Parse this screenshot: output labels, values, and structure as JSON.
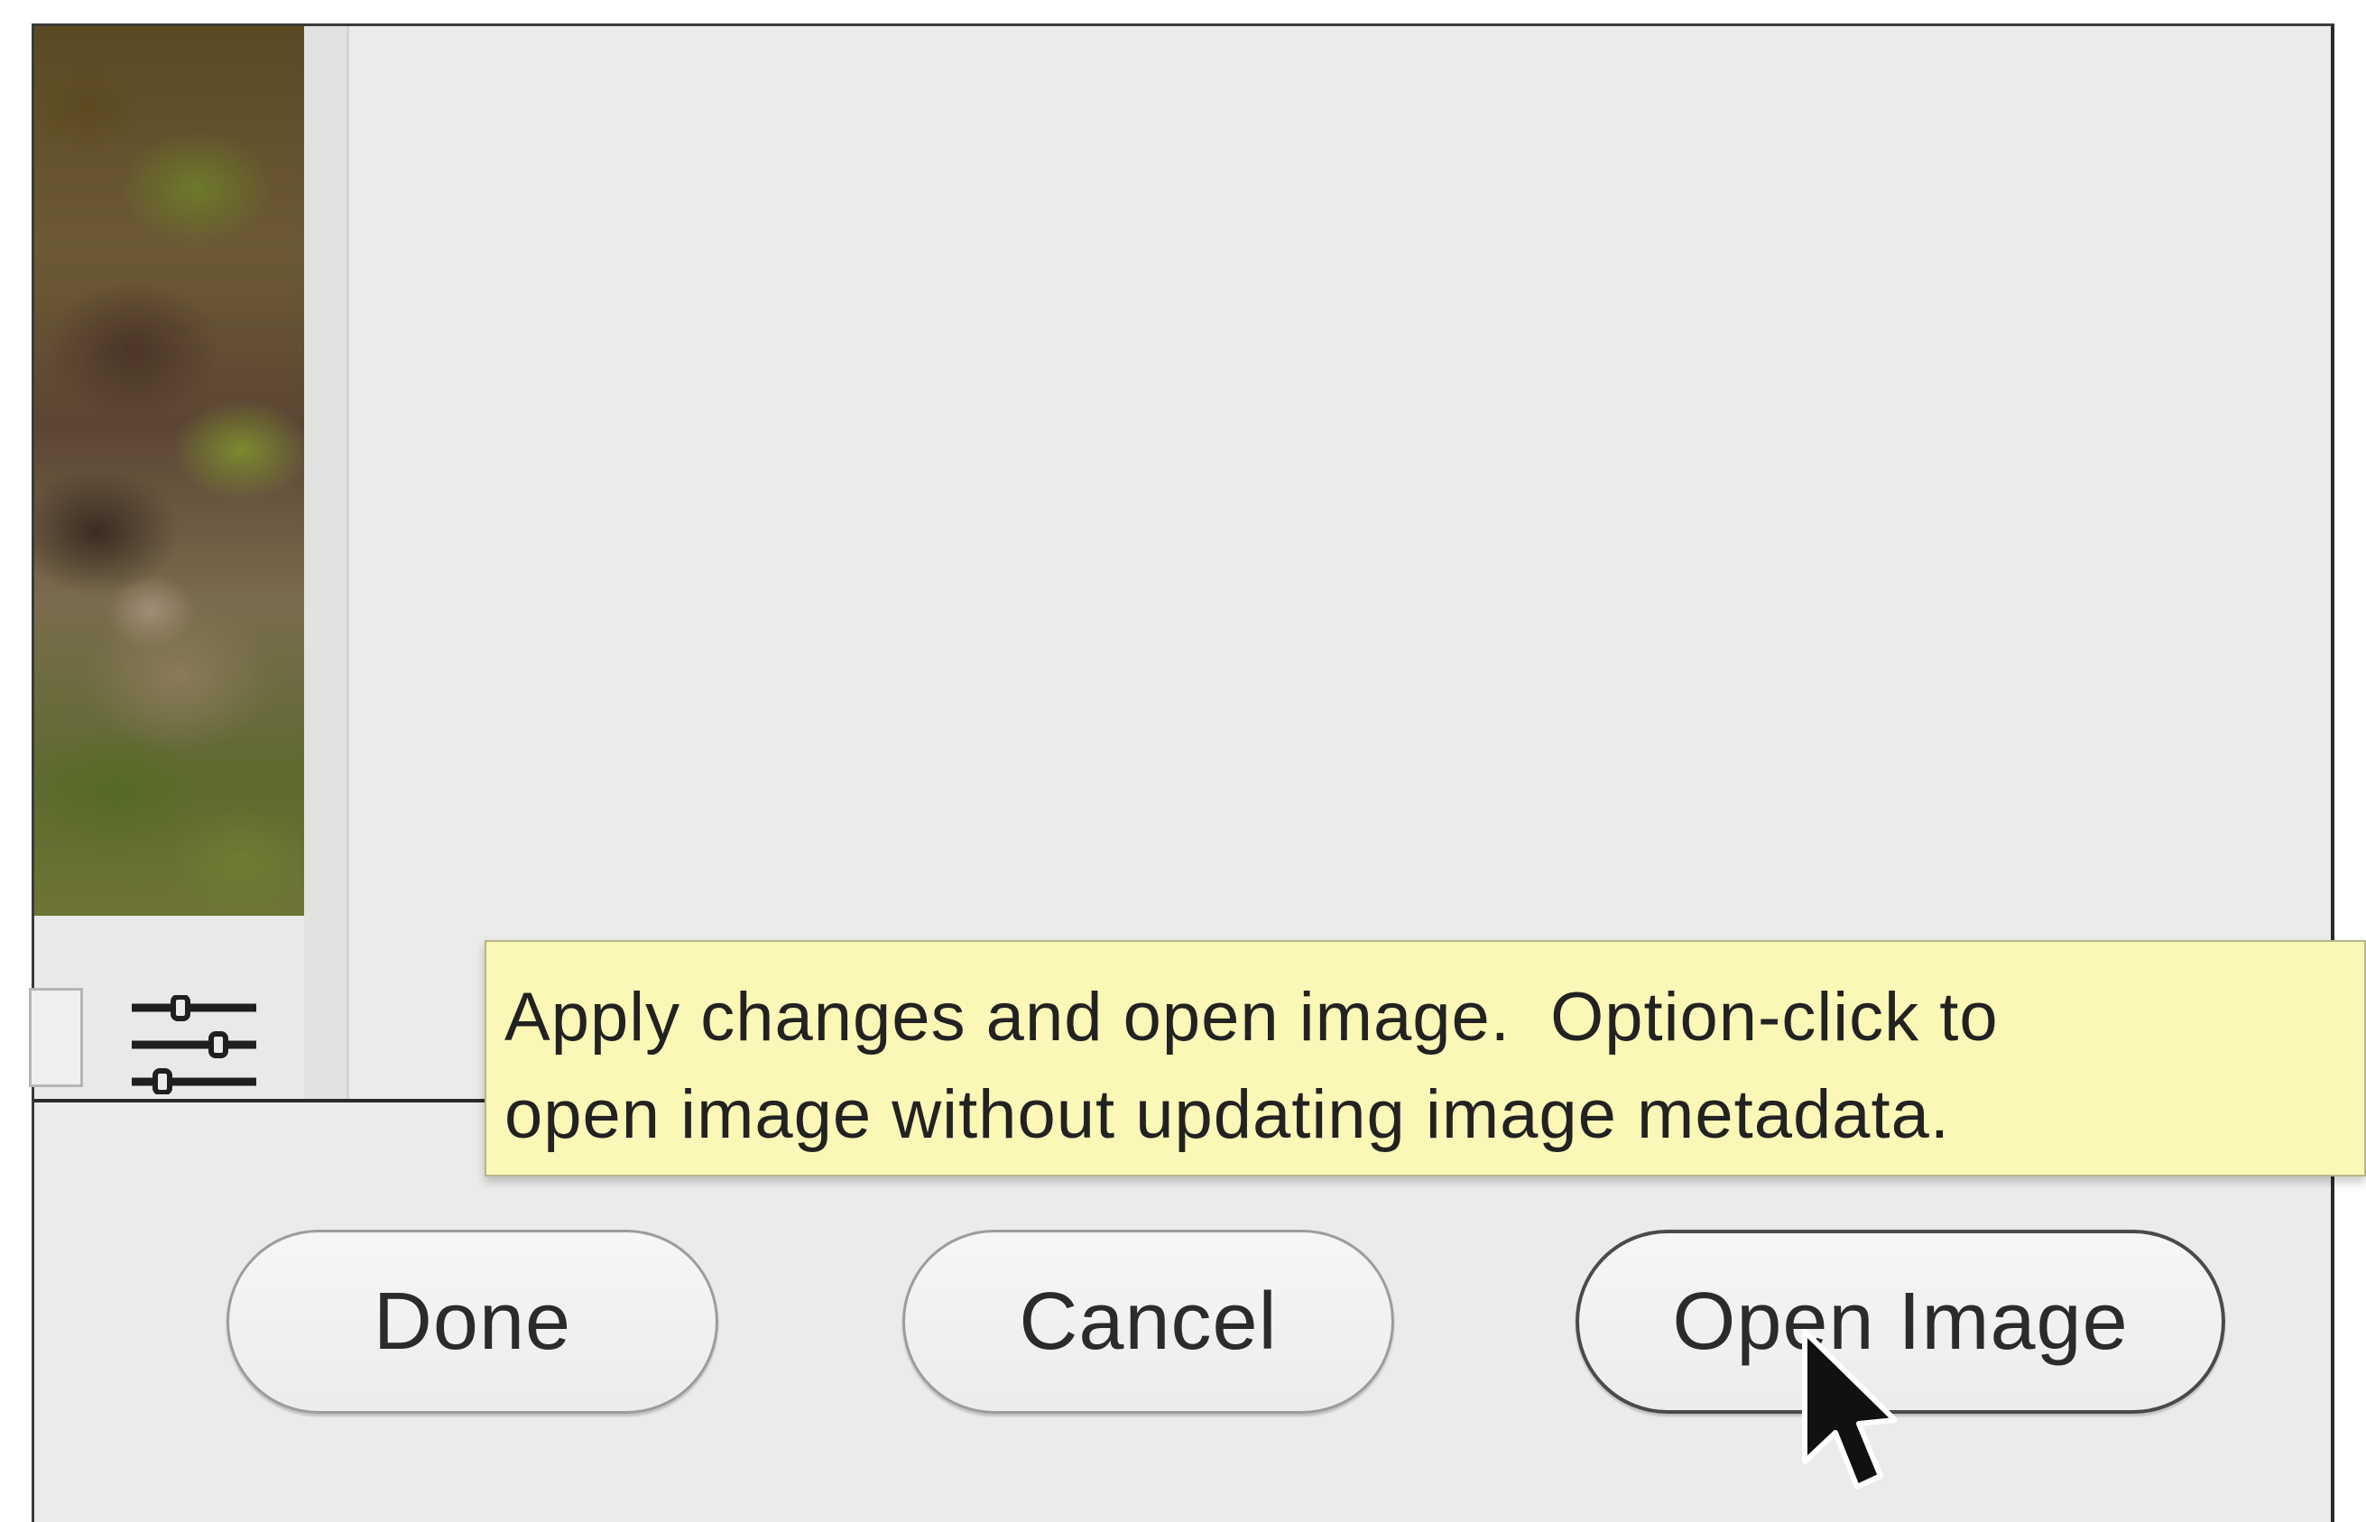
{
  "tooltip": {
    "line1": "Apply changes and open image.  Option-click to",
    "line2": "open image without updating image metadata."
  },
  "buttons": {
    "done_label": "Done",
    "cancel_label": "Cancel",
    "open_image_label": "Open Image"
  },
  "icons": {
    "sliders": "sliders-icon",
    "cursor": "mouse-pointer-icon"
  },
  "colors": {
    "window_bg": "#ebebea",
    "tooltip_bg": "#fbf7b6",
    "text": "#2b2b2b"
  }
}
